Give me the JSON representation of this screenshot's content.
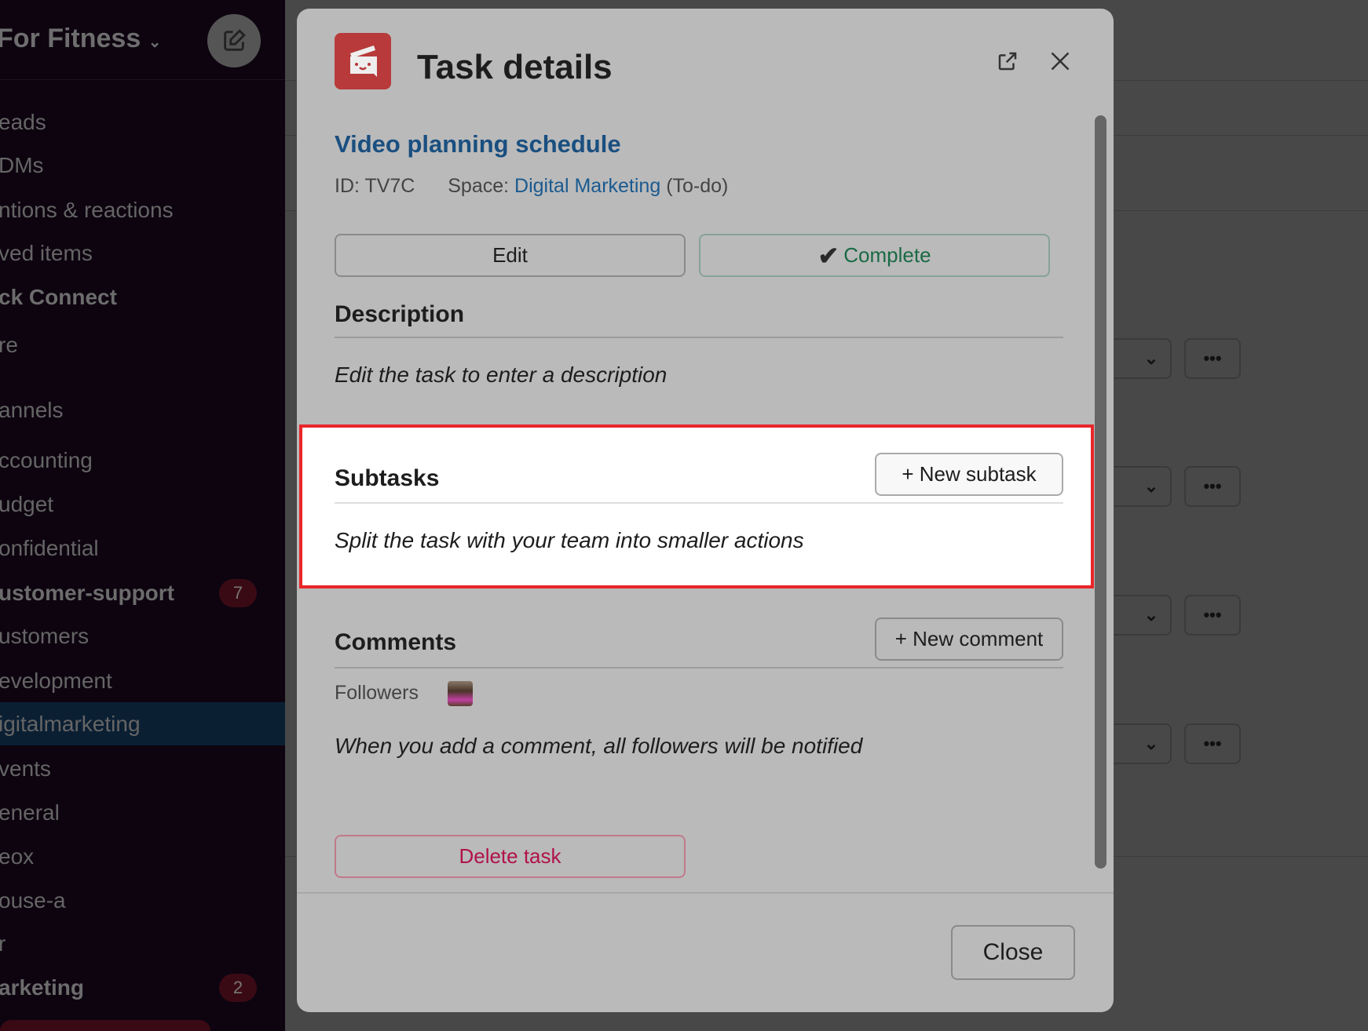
{
  "sidebar": {
    "workspace_title": "For Fitness",
    "items": [
      {
        "label": "eads",
        "bold": false
      },
      {
        "label": "DMs",
        "bold": false
      },
      {
        "label": "ntions & reactions",
        "bold": false
      },
      {
        "label": "ved items",
        "bold": false
      },
      {
        "label": "ck Connect",
        "bold": true
      },
      {
        "label": "re",
        "bold": false
      },
      {
        "label": "annels",
        "bold": false
      },
      {
        "label": "ccounting",
        "bold": false
      },
      {
        "label": "udget",
        "bold": false
      },
      {
        "label": "onfidential",
        "bold": false
      },
      {
        "label": "ustomer-support",
        "bold": true,
        "badge": "7"
      },
      {
        "label": "ustomers",
        "bold": false
      },
      {
        "label": "evelopment",
        "bold": false
      },
      {
        "label": "igitalmarketing",
        "bold": false,
        "selected": true
      },
      {
        "label": "vents",
        "bold": false
      },
      {
        "label": "eneral",
        "bold": false
      },
      {
        "label": "eox",
        "bold": false
      },
      {
        "label": "ouse-a",
        "bold": false
      },
      {
        "label": "r",
        "bold": false
      },
      {
        "label": "arketing",
        "bold": true,
        "badge": "2"
      }
    ]
  },
  "background": {
    "row_more_label": "•••"
  },
  "modal": {
    "title": "Task details",
    "task_name": "Video planning schedule",
    "id_label": "ID: TV7C",
    "space_label": "Space:",
    "space_link": "Digital Marketing",
    "space_status": "(To-do)",
    "edit_label": "Edit",
    "complete_label": "Complete",
    "description": {
      "heading": "Description",
      "placeholder": "Edit the task to enter a description"
    },
    "subtasks": {
      "heading": "Subtasks",
      "button": "+ New subtask",
      "placeholder": "Split the task with your team into smaller actions"
    },
    "comments": {
      "heading": "Comments",
      "button": "+ New comment",
      "followers_label": "Followers",
      "placeholder": "When you add a comment, all followers will be notified"
    },
    "delete_label": "Delete task",
    "close_label": "Close"
  },
  "colors": {
    "accent_link": "#1a4f80",
    "complete_green": "#1a6a45",
    "delete_red": "#b0124a",
    "highlight_border": "#e8262a",
    "app_icon": "#b83a3a"
  }
}
